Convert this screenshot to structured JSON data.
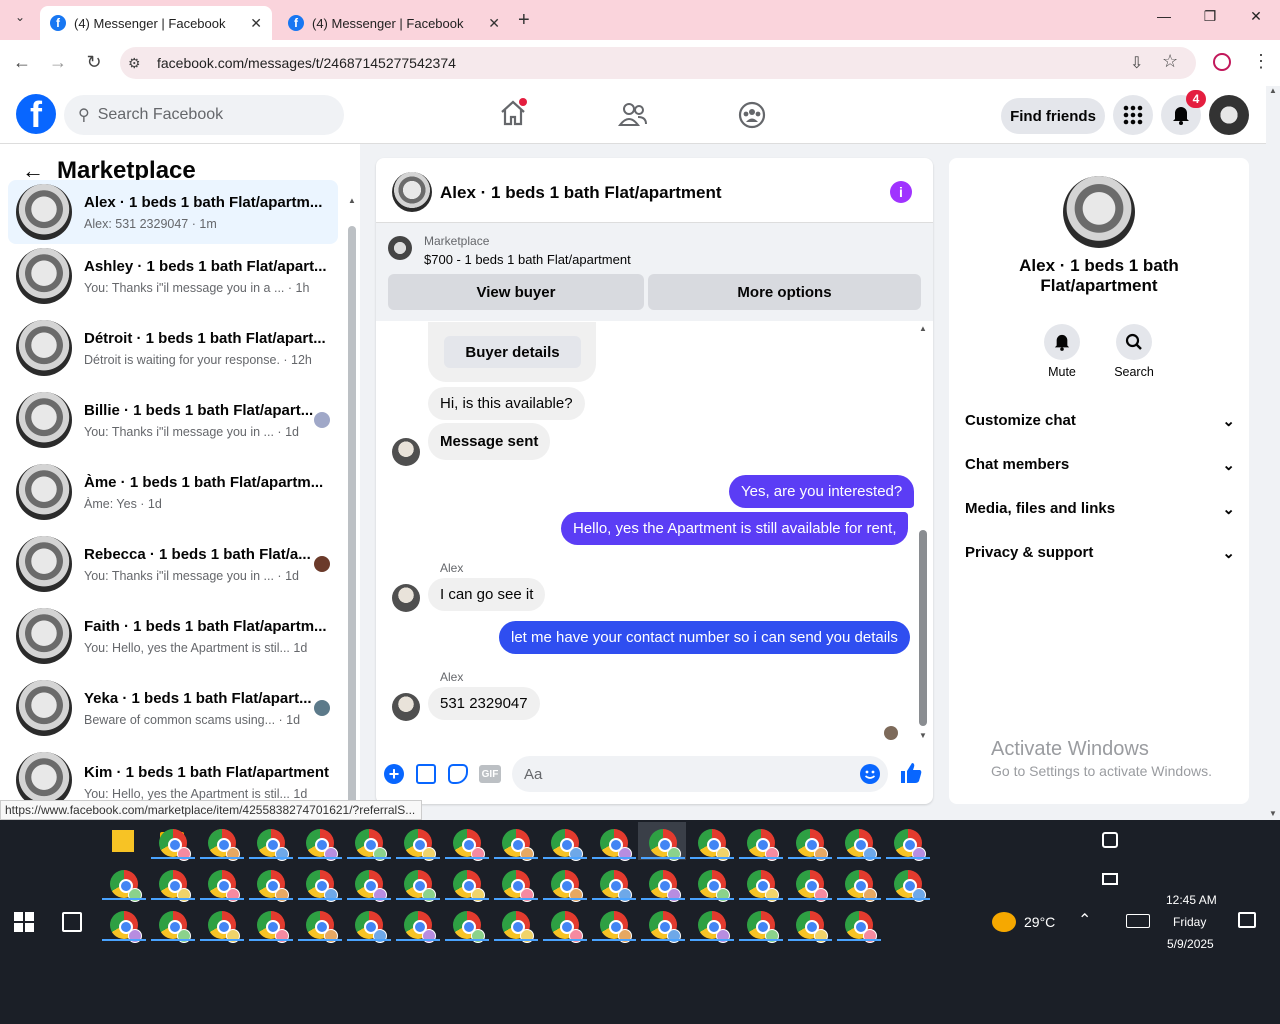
{
  "browser": {
    "tabs": [
      {
        "title": "(4) Messenger | Facebook"
      },
      {
        "title": "(4) Messenger | Facebook"
      }
    ],
    "url": "facebook.com/messages/t/24687145277542374",
    "new_tab_symbol": "+"
  },
  "fb_header": {
    "search_placeholder": "Search Facebook",
    "find_friends": "Find friends",
    "notif_count": "4"
  },
  "left_pane": {
    "title": "Marketplace",
    "conversations": [
      {
        "name": "Alex · 1 beds 1 bath Flat/apartm...",
        "meta": "Alex: 531 2329047 · 1m"
      },
      {
        "name": "Ashley · 1 beds 1 bath Flat/apart...",
        "meta": "You: Thanks i\"il message you in a ... · 1h"
      },
      {
        "name": "Détroit · 1 beds 1 bath Flat/apart...",
        "meta": "Détroit is waiting for your response. · 12h"
      },
      {
        "name": "Billie · 1 beds 1 bath Flat/apart...",
        "meta": "You: Thanks i\"il message you in ... · 1d"
      },
      {
        "name": "Àme · 1 beds 1 bath Flat/apartm...",
        "meta": "Àme: Yes · 1d"
      },
      {
        "name": "Rebecca · 1 beds 1 bath Flat/a...",
        "meta": "You: Thanks i\"il message you in ... · 1d"
      },
      {
        "name": "Faith · 1 beds 1 bath Flat/apartm...",
        "meta": "You: Hello, yes the Apartment is stil... 1d"
      },
      {
        "name": "Yeka · 1 beds 1 bath Flat/apart...",
        "meta": "Beware of common scams using... · 1d"
      },
      {
        "name": "Kim · 1 beds 1 bath Flat/apartment",
        "meta": "You: Hello, yes the Apartment is stil... 1d"
      }
    ]
  },
  "chat": {
    "title": "Alex · 1 beds 1 bath Flat/apartment",
    "listing_source": "Marketplace",
    "listing_summary": "$700 - 1 beds 1 bath Flat/apartment",
    "view_buyer": "View buyer",
    "more_options": "More options",
    "buyer_details": "Buyer details",
    "msg_available": "Hi, is this available?",
    "msg_sent": "Message sent",
    "out1": "Yes, are you interested?",
    "out2": "Hello, yes the Apartment is still available for rent,",
    "sender": "Alex",
    "in_see": "I can go see it",
    "out3": "let me have your contact number so i can send you details",
    "in_number": "531 2329047",
    "composer_placeholder": "Aa",
    "gif": "GIF"
  },
  "right_pane": {
    "name": "Alex · 1 beds 1 bath Flat/apartment",
    "mute": "Mute",
    "search": "Search",
    "sections": [
      "Customize chat",
      "Chat members",
      "Media, files and links",
      "Privacy & support"
    ]
  },
  "watermark": {
    "title": "Activate Windows",
    "sub": "Go to Settings to activate Windows."
  },
  "status_url": "https://www.facebook.com/marketplace/item/4255838274701621/?referralS...",
  "taskbar": {
    "temp": "29°C",
    "time": "12:45 AM",
    "day": "Friday",
    "date": "5/9/2025"
  },
  "colors": {
    "fb_blue": "#0866ff",
    "messenger_purple": "#5b3df5",
    "tab_bg": "#fad4dc"
  }
}
